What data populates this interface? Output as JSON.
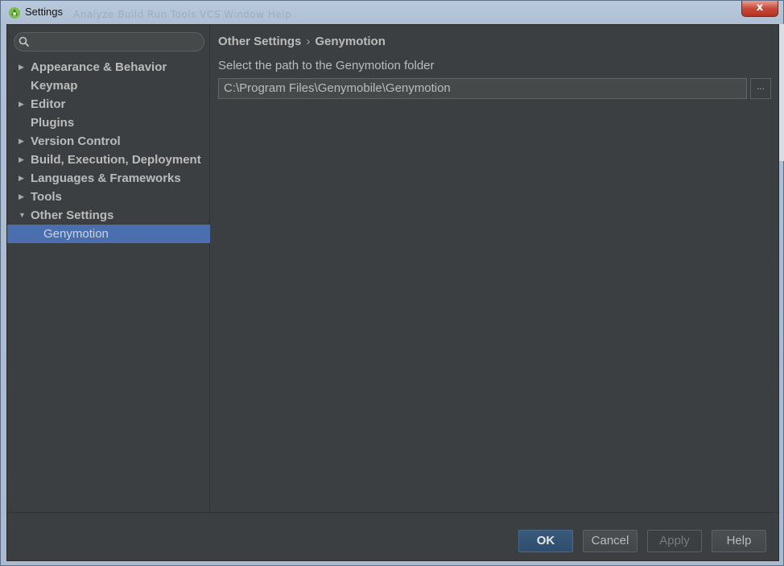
{
  "window": {
    "title": "Settings",
    "background_menu_hint": "Analyze  Build  Run  Tools  VCS  Window  Help",
    "close_label": "x"
  },
  "search": {
    "placeholder": "",
    "value": ""
  },
  "tree": [
    {
      "label": "Appearance & Behavior",
      "expandable": true,
      "expanded": false
    },
    {
      "label": "Keymap",
      "expandable": false
    },
    {
      "label": "Editor",
      "expandable": true,
      "expanded": false
    },
    {
      "label": "Plugins",
      "expandable": false
    },
    {
      "label": "Version Control",
      "expandable": true,
      "expanded": false
    },
    {
      "label": "Build, Execution, Deployment",
      "expandable": true,
      "expanded": false
    },
    {
      "label": "Languages & Frameworks",
      "expandable": true,
      "expanded": false
    },
    {
      "label": "Tools",
      "expandable": true,
      "expanded": false
    },
    {
      "label": "Other Settings",
      "expandable": true,
      "expanded": true
    },
    {
      "label": "Genymotion",
      "child": true,
      "selected": true
    }
  ],
  "breadcrumb": {
    "parent": "Other Settings",
    "separator": "›",
    "current": "Genymotion"
  },
  "genymotion": {
    "path_label": "Select the path to the Genymotion folder",
    "path_value": "C:\\Program Files\\Genymobile\\Genymotion",
    "browse_label": "..."
  },
  "buttons": {
    "ok": "OK",
    "cancel": "Cancel",
    "apply": "Apply",
    "help": "Help"
  },
  "colors": {
    "panel_bg": "#3c3f41",
    "selection": "#4b6eaf",
    "text": "#bbbbbb",
    "default_button": "#365880"
  }
}
